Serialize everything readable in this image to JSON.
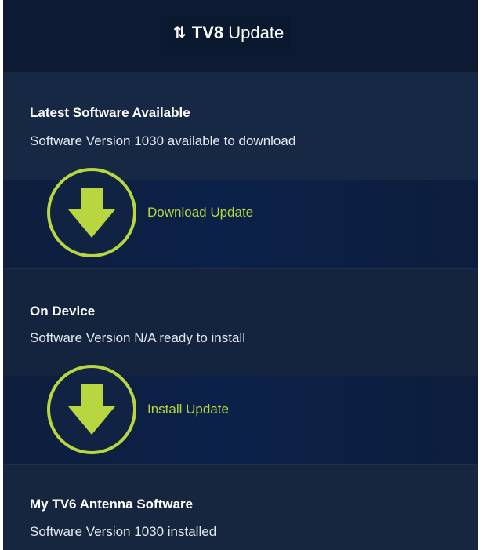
{
  "header": {
    "icon": "up-down-arrows-icon",
    "title_prefix": "TV8",
    "title_suffix": " Update"
  },
  "latest": {
    "heading": "Latest Software Available",
    "text": "Software Version 1030 available to download",
    "action_label": "Download Update",
    "action_icon": "download-arrow-icon"
  },
  "device": {
    "heading": "On Device",
    "text": "Software Version N/A ready to install",
    "action_label": "Install Update",
    "action_icon": "download-arrow-icon"
  },
  "antenna": {
    "heading": "My TV6 Antenna Software",
    "text": "Software Version 1030 installed"
  },
  "colors": {
    "accent": "#b5d63e",
    "background": "#15223a",
    "header": "#0c1a34"
  }
}
